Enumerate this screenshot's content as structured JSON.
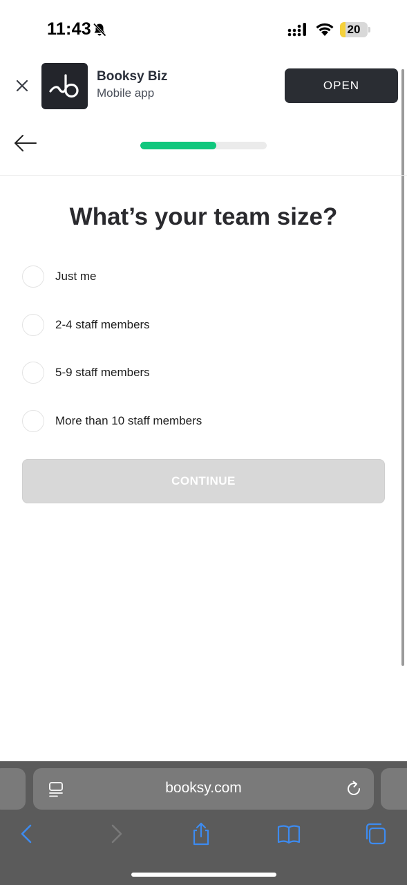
{
  "status_bar": {
    "time": "11:43",
    "battery": "20",
    "battery_level_percent": 20,
    "icons": [
      "bell-slash-icon",
      "signal-icon",
      "wifi-icon",
      "battery-icon"
    ]
  },
  "app_banner": {
    "name": "Booksy Biz",
    "subtitle": "Mobile app",
    "open_label": "OPEN",
    "logo_icon": "booksy-logo-icon",
    "close_icon": "close-icon"
  },
  "header": {
    "back_icon": "arrow-left-icon",
    "progress_percent": 60
  },
  "main": {
    "title": "What’s your team size?",
    "options": [
      {
        "label": "Just me",
        "selected": false
      },
      {
        "label": "2-4 staff members",
        "selected": false
      },
      {
        "label": "5-9 staff members",
        "selected": false
      },
      {
        "label": "More than 10 staff members",
        "selected": false
      }
    ],
    "continue_label": "CONTINUE",
    "continue_enabled": false
  },
  "browser": {
    "url": "booksy.com",
    "toolbar_icons": [
      "back-chevron-icon",
      "forward-chevron-icon",
      "share-icon",
      "bookmarks-icon",
      "tabs-icon"
    ]
  },
  "colors": {
    "accent": "#10c77d",
    "banner_button": "#2a2d33",
    "disabled_button": "#d8d8d8",
    "ios_blue": "#3d8bf0",
    "browser_bar": "#5b5b5b"
  }
}
